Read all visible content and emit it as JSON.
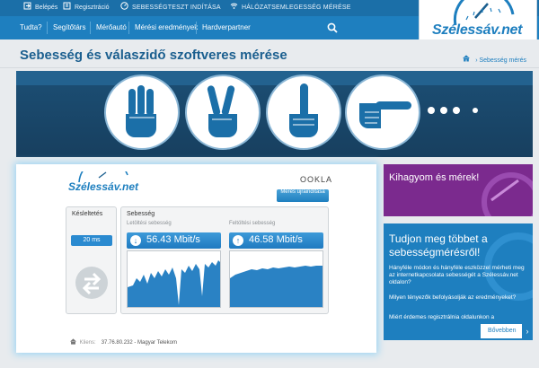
{
  "topbar": {
    "login": "Belépés",
    "register": "Regisztráció",
    "speedtest_start": "SEBESSÉGTESZT INDÍTÁSA",
    "coverage_test": "HÁLÓZATSEMLEGESSÉG MÉRÉSE"
  },
  "nav": {
    "items": [
      "Tudta?",
      "Segítőtárs",
      "Mérőautó",
      "Mérési eredmények",
      "Hardverpartner"
    ]
  },
  "logo": "Szélessáv.net",
  "page": {
    "title": "Sebesség és válaszidő szoftveres mérése",
    "breadcrumb": "Sebesség mérés"
  },
  "speedtest": {
    "logo": "Szélessáv.net",
    "ookla": "OOKLA",
    "restart_button": "Mérés újraindítása",
    "latency_title": "Késleltetés",
    "latency_value": "20 ms",
    "speed_title": "Sebesség",
    "download_label": "Letöltési sebesség",
    "download_value": "56.43 Mbit/s",
    "upload_label": "Feltöltési sebesség",
    "upload_value": "46.58 Mbit/s",
    "client_label": "Kliens:",
    "client_value": "37.76.80.232 - Magyar Telekom"
  },
  "promo": {
    "text": "Kihagyom és mérek!"
  },
  "info": {
    "title": "Tudjon meg többet a sebességmérésről!",
    "questions": [
      "Hányféle módon és hányféle eszközzel mérheti meg az internetkapcsolata sebességét a Szélessáv.net oldalon?",
      "Milyen tényezők befolyásolják az eredményeket?",
      "Miért érdemes regisztrálnia oldalunkon a"
    ],
    "more": "Bővebben"
  },
  "colors": {
    "primary": "#1e7fbf",
    "dark_blue": "#1b6fa8",
    "purple": "#7b2a8e",
    "banner": "#1c4f75"
  },
  "icons": {
    "login": "login-icon",
    "register": "register-icon",
    "speedtest": "speedometer-icon",
    "coverage": "signal-icon",
    "search": "search-icon",
    "home": "home-icon"
  }
}
